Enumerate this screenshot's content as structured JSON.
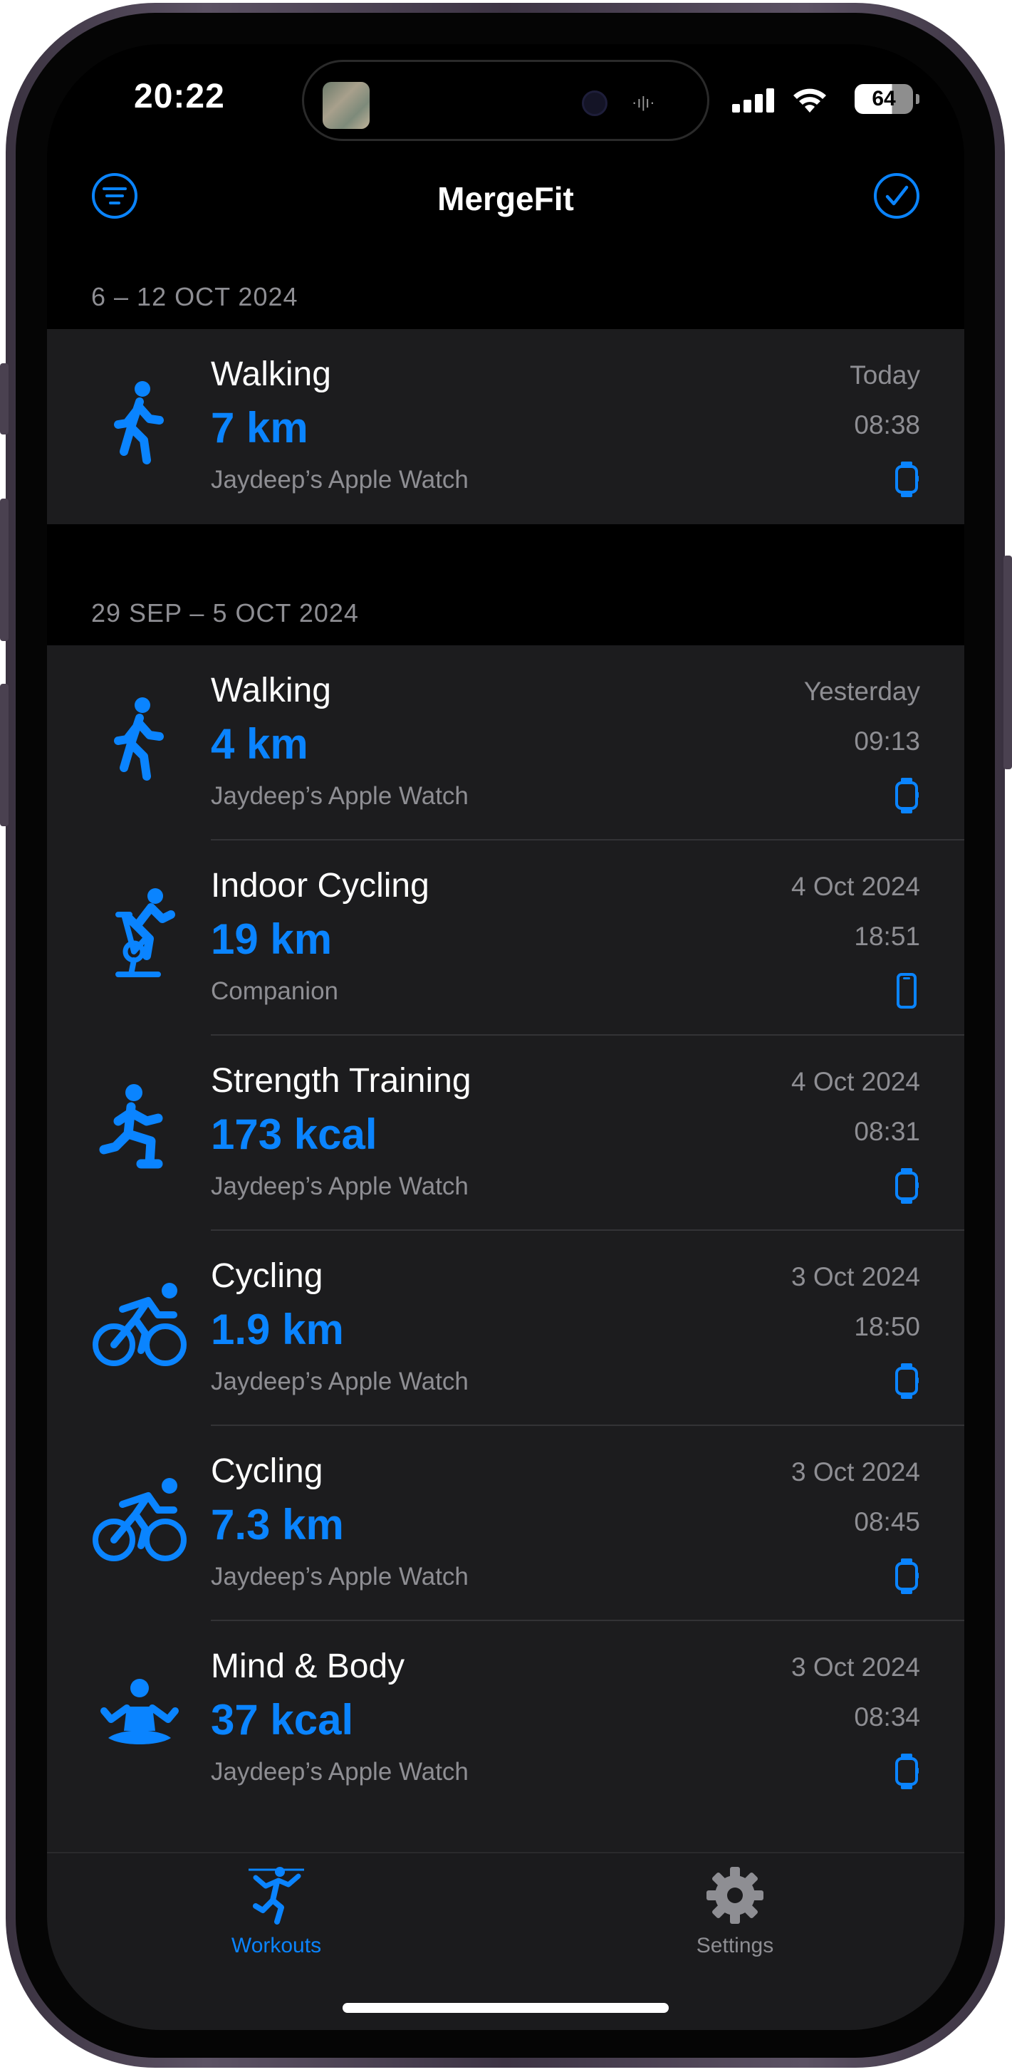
{
  "status_bar": {
    "time": "20:22",
    "battery": "64"
  },
  "nav": {
    "title": "MergeFit"
  },
  "colors": {
    "accent": "#0a84ff",
    "background": "#000000",
    "cell": "#1c1c1e",
    "secondary_text": "#8e8e93"
  },
  "sections": [
    {
      "header": "6 – 12 OCT 2024",
      "workouts": [
        {
          "name": "Walking",
          "value": "7 km",
          "source": "Jaydeep’s Apple Watch",
          "date": "Today",
          "time": "08:38",
          "icon": "walking-icon",
          "device": "watch-icon"
        }
      ]
    },
    {
      "header": "29 SEP – 5 OCT 2024",
      "workouts": [
        {
          "name": "Walking",
          "value": "4 km",
          "source": "Jaydeep’s Apple Watch",
          "date": "Yesterday",
          "time": "09:13",
          "icon": "walking-icon",
          "device": "watch-icon"
        },
        {
          "name": "Indoor Cycling",
          "value": "19 km",
          "source": "Companion",
          "date": "4 Oct 2024",
          "time": "18:51",
          "icon": "indoor-cycling-icon",
          "device": "phone-icon"
        },
        {
          "name": "Strength Training",
          "value": "173 kcal",
          "source": "Jaydeep’s Apple Watch",
          "date": "4 Oct 2024",
          "time": "08:31",
          "icon": "strength-training-icon",
          "device": "watch-icon"
        },
        {
          "name": "Cycling",
          "value": "1.9 km",
          "source": "Jaydeep’s Apple Watch",
          "date": "3 Oct 2024",
          "time": "18:50",
          "icon": "cycling-icon",
          "device": "watch-icon"
        },
        {
          "name": "Cycling",
          "value": "7.3 km",
          "source": "Jaydeep’s Apple Watch",
          "date": "3 Oct 2024",
          "time": "08:45",
          "icon": "cycling-icon",
          "device": "watch-icon"
        },
        {
          "name": "Mind & Body",
          "value": "37 kcal",
          "source": "Jaydeep’s Apple Watch",
          "date": "3 Oct 2024",
          "time": "08:34",
          "icon": "mind-body-icon",
          "device": "watch-icon"
        }
      ]
    }
  ],
  "tabs": [
    {
      "label": "Workouts",
      "icon": "workouts-icon",
      "selected": true
    },
    {
      "label": "Settings",
      "icon": "gear-icon",
      "selected": false
    }
  ]
}
